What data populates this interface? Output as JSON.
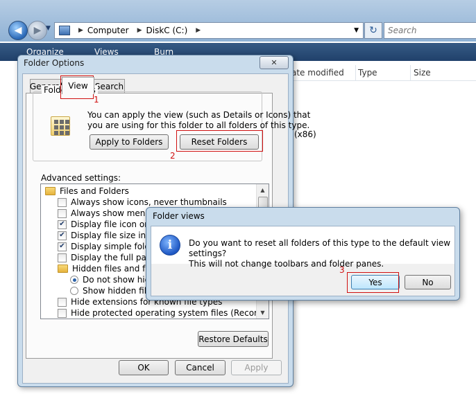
{
  "explorer": {
    "breadcrumb": [
      "Computer",
      "DiskC (C:)"
    ],
    "search_placeholder": "Search",
    "toolbar": [
      "Organize",
      "Views",
      "Burn"
    ],
    "columns": [
      "ate modified",
      "Type",
      "Size"
    ],
    "partial_text": "(x86)"
  },
  "folder_options": {
    "title": "Folder Options",
    "tabs": [
      "General",
      "View",
      "Search"
    ],
    "folder_views": {
      "label": "Folder views",
      "description_line1": "You can apply the view (such as Details or Icons) that",
      "description_line2": "you are using for this folder to all folders of this type.",
      "apply_button": "Apply to Folders",
      "reset_button": "Reset Folders"
    },
    "advanced_label": "Advanced settings:",
    "advanced_items": [
      {
        "kind": "folder",
        "label": "Files and Folders",
        "indent": 0
      },
      {
        "kind": "check",
        "checked": false,
        "label": "Always show icons, never thumbnails",
        "indent": 1
      },
      {
        "kind": "check",
        "checked": false,
        "label": "Always show menus",
        "indent": 1
      },
      {
        "kind": "check",
        "checked": true,
        "label": "Display file icon on thumbnails",
        "indent": 1
      },
      {
        "kind": "check",
        "checked": true,
        "label": "Display file size information in folder tips",
        "indent": 1
      },
      {
        "kind": "check",
        "checked": true,
        "label": "Display simple folder view in Navigation pane",
        "indent": 1
      },
      {
        "kind": "check",
        "checked": false,
        "label": "Display the full path in the title bar",
        "indent": 1
      },
      {
        "kind": "folder",
        "label": "Hidden files and folders",
        "indent": 1
      },
      {
        "kind": "radio",
        "checked": true,
        "label": "Do not show hidden files and folders",
        "indent": 2
      },
      {
        "kind": "radio",
        "checked": false,
        "label": "Show hidden files and folders",
        "indent": 2
      },
      {
        "kind": "check",
        "checked": false,
        "label": "Hide extensions for known file types",
        "indent": 1
      },
      {
        "kind": "check",
        "checked": false,
        "label": "Hide protected operating system files (Recommended)",
        "indent": 1
      }
    ],
    "restore_defaults": "Restore Defaults",
    "ok": "OK",
    "cancel": "Cancel",
    "apply": "Apply"
  },
  "message_box": {
    "title": "Folder views",
    "line1": "Do you want to reset all folders of this type to the default view settings?",
    "line2": "This will not change toolbars and folder panes.",
    "yes": "Yes",
    "no": "No"
  },
  "annotations": [
    "1",
    "2",
    "3"
  ],
  "colors": {
    "highlight": "#d01010",
    "title_bar": "#c9dcec"
  }
}
